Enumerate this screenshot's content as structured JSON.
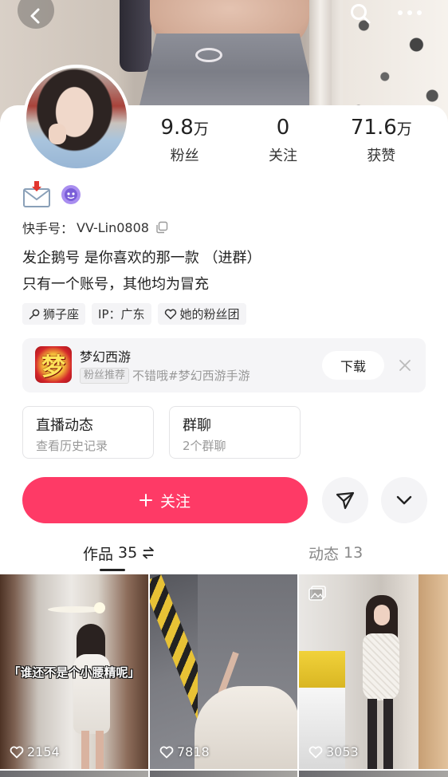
{
  "header": {
    "back_icon": "chevron-left-icon",
    "search_icon": "search-icon",
    "more_icon": "more-icon"
  },
  "profile": {
    "stats": [
      {
        "value": "9.8",
        "unit": "万",
        "label": "粉丝"
      },
      {
        "value": "0",
        "unit": "",
        "label": "关注"
      },
      {
        "value": "71.6",
        "unit": "万",
        "label": "获赞"
      }
    ],
    "badges": [
      "mail-icon",
      "fan-badge-icon"
    ],
    "id_label": "快手号：",
    "id_value": "VV-Lin0808",
    "copy_icon": "copy-icon",
    "bio": [
      "发企鹅号 是你喜欢的那一款  （进群）",
      "只有一个账号，其他均为冒充"
    ],
    "tags": [
      {
        "text": "狮子座",
        "icon": "zodiac-icon"
      },
      {
        "text": "IP：广东",
        "icon": ""
      },
      {
        "text": "她的粉丝团",
        "icon": "fan-club-icon"
      }
    ]
  },
  "promo": {
    "logo_char": "梦",
    "title": "梦幻西游",
    "tag": "粉丝推荐",
    "desc": "不错哦#梦幻西游手游",
    "button": "下载",
    "close_icon": "close-icon"
  },
  "shortcuts": [
    {
      "title": "直播动态",
      "subtitle": "查看历史记录"
    },
    {
      "title": "群聊",
      "subtitle": "2个群聊"
    }
  ],
  "actions": {
    "follow_label": "关注",
    "follow_icon": "plus-icon",
    "share_icon": "share-icon",
    "expand_icon": "chevron-down-icon"
  },
  "tabs": [
    {
      "label": "作品",
      "count": "35",
      "icon": "sort-icon",
      "active": true
    },
    {
      "label": "动态",
      "count": "13",
      "active": false
    }
  ],
  "posts": [
    {
      "likes": "2154",
      "caption": "「谁还不是个小腰精呢」"
    },
    {
      "likes": "7818",
      "caption": ""
    },
    {
      "likes": "3053",
      "caption": "",
      "badge_icon": "image-icon"
    }
  ],
  "colors": {
    "accent": "#fe3a66",
    "text": "#222222",
    "muted": "#999999",
    "pill_bg": "#f4f4f6"
  }
}
